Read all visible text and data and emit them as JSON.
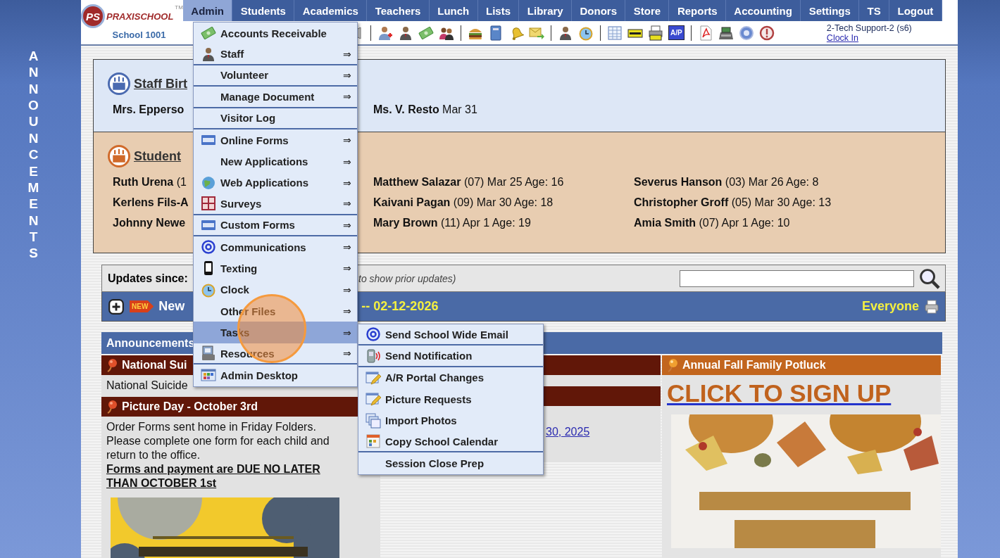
{
  "logo": {
    "monogram": "PS",
    "name": "PRAXISCHOOL",
    "tm": "TM",
    "school": "School 1001"
  },
  "nav": [
    {
      "label": "Admin",
      "selected": true
    },
    {
      "label": "Students",
      "selected": false
    },
    {
      "label": "Academics",
      "selected": false
    },
    {
      "label": "Teachers",
      "selected": false
    },
    {
      "label": "Lunch",
      "selected": false
    },
    {
      "label": "Lists",
      "selected": false
    },
    {
      "label": "Library",
      "selected": false
    },
    {
      "label": "Donors",
      "selected": false
    },
    {
      "label": "Store",
      "selected": false
    },
    {
      "label": "Reports",
      "selected": false
    },
    {
      "label": "Accounting",
      "selected": false
    },
    {
      "label": "Settings",
      "selected": false
    },
    {
      "label": "TS",
      "selected": false
    },
    {
      "label": "Logout",
      "selected": false
    }
  ],
  "toolbar": {
    "ap_label": "A/P"
  },
  "user": {
    "name": "2-Tech Support-2 (s6)",
    "clock_link": "Clock In"
  },
  "side_banner": "ANNOUNCEMENTS",
  "staff_birthdays": {
    "title": "Staff Birt",
    "people": [
      {
        "name": "Mrs. Epperso"
      },
      {
        "name": "Ms. V. Resto",
        "detail": "Mar 31"
      }
    ]
  },
  "student_birthdays": {
    "title": "Student",
    "people": [
      {
        "name": "Ruth Urena",
        "detail": "(1"
      },
      {
        "name": "Matthew Salazar",
        "detail": "(07) Mar 25 Age: 16"
      },
      {
        "name": "Severus Hanson",
        "detail": "(03) Mar 26 Age: 8"
      },
      {
        "name": "Kerlens Fils-A"
      },
      {
        "name": "Kaivani Pagan",
        "detail": "(09) Mar 30 Age: 18"
      },
      {
        "name": "Christopher Groff",
        "detail": "(05) Mar 30 Age: 13"
      },
      {
        "name": "Johnny Newe"
      },
      {
        "name": "Mary Brown",
        "detail": "(11) Apr 1 Age: 19"
      },
      {
        "name": "Amia Smith",
        "detail": "(07) Apr 1 Age: 10"
      }
    ]
  },
  "updates": {
    "label": "Updates since:",
    "hint": "to show prior updates)"
  },
  "news_bar": {
    "new_badge": "NEW",
    "title": "New",
    "date": "-- 02-12-2026",
    "audience": "Everyone"
  },
  "announcements": {
    "title": "Announcements",
    "left": [
      {
        "title": "National Sui",
        "body": "National Suicide"
      },
      {
        "title": "Picture Day - October 3rd",
        "body": "Order Forms sent home in Friday Folders. Please complete one form for each child and return to the office.",
        "notice": "Forms and payment are DUE NO LATER THAN OCTOBER 1st",
        "kind": "picture"
      }
    ],
    "middle": {
      "link": "30, 2025"
    },
    "right": {
      "title": "Annual Fall Family Potluck",
      "link": "CLICK TO SIGN UP",
      "kind": "picture"
    }
  },
  "admin_menu": [
    {
      "label": "Accounts Receivable",
      "selected": false,
      "separator_after": false
    },
    {
      "label": "Staff",
      "arrow": "⇒",
      "selected": false,
      "separator_after": true
    },
    {
      "label": "Volunteer",
      "arrow": "⇒",
      "selected": false,
      "separator_after": true
    },
    {
      "label": "Manage Document",
      "arrow": "⇒",
      "selected": false,
      "separator_after": true
    },
    {
      "label": "Visitor Log",
      "selected": false,
      "separator_after": true
    },
    {
      "label": "Online Forms",
      "arrow": "⇒",
      "selected": false,
      "separator_after": false
    },
    {
      "label": "New Applications",
      "arrow": "⇒",
      "selected": false,
      "separator_after": false
    },
    {
      "label": "Web Applications",
      "arrow": "⇒",
      "selected": false,
      "separator_after": false
    },
    {
      "label": "Surveys",
      "arrow": "⇒",
      "selected": false,
      "separator_after": true
    },
    {
      "label": "Custom Forms",
      "arrow": "⇒",
      "selected": false,
      "separator_after": true
    },
    {
      "label": "Communications",
      "arrow": "⇒",
      "selected": false,
      "separator_after": false
    },
    {
      "label": "Texting",
      "arrow": "⇒",
      "selected": false,
      "separator_after": false
    },
    {
      "label": "Clock",
      "arrow": "⇒",
      "selected": false,
      "separator_after": false
    },
    {
      "label": "Other Files",
      "arrow": "⇒",
      "selected": false,
      "separator_after": false
    },
    {
      "label": "Tasks",
      "arrow": "⇒",
      "selected": true,
      "separator_after": false
    },
    {
      "label": "Resources",
      "arrow": "⇒",
      "selected": false,
      "separator_after": true
    },
    {
      "label": "Admin Desktop",
      "selected": false,
      "separator_after": false
    }
  ],
  "tasks_submenu": [
    {
      "label": "Send School Wide Email",
      "separator_after": true
    },
    {
      "label": "Send Notification",
      "separator_after": true
    },
    {
      "label": "A/R Portal Changes",
      "separator_after": false
    },
    {
      "label": "Picture Requests",
      "separator_after": false
    },
    {
      "label": "Import Photos",
      "separator_after": false
    },
    {
      "label": "Copy School Calendar",
      "separator_after": true
    },
    {
      "label": "Session Close Prep",
      "separator_after": false
    }
  ]
}
